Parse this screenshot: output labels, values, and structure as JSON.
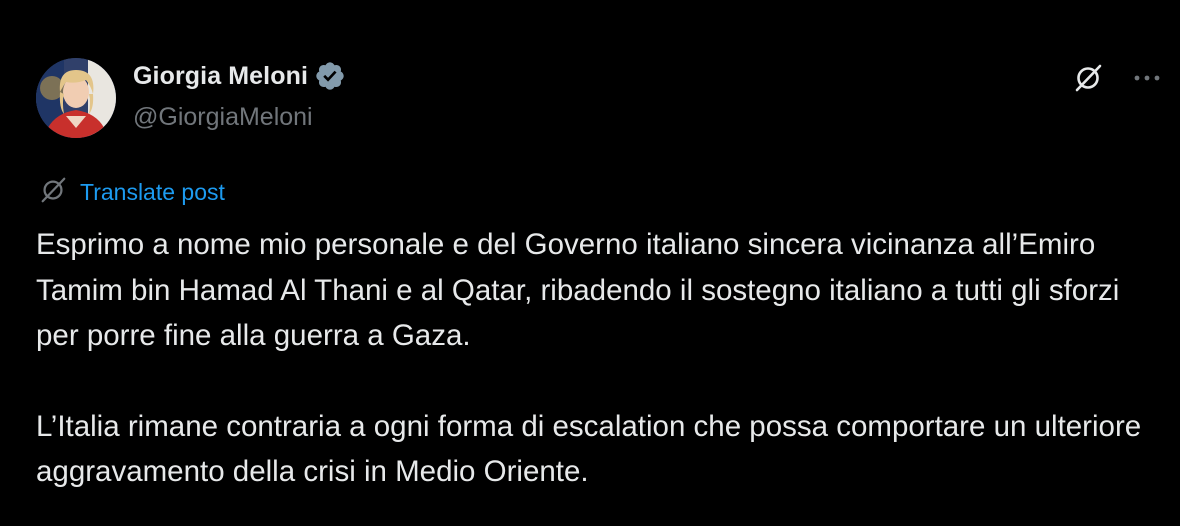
{
  "colors": {
    "background": "#000000",
    "text": "#e7e9ea",
    "secondary": "#71767b",
    "accent": "#1d9bf0"
  },
  "author": {
    "name": "Giorgia Meloni",
    "handle": "@GiorgiaMeloni",
    "verified_icon": "verified-badge-icon",
    "avatar_icon": "avatar"
  },
  "actions": {
    "grok_icon": "grok-icon",
    "more_icon": "more-options-icon"
  },
  "translate": {
    "icon": "translate-icon",
    "label": "Translate post"
  },
  "post": {
    "paragraphs": [
      "Esprimo a nome mio personale e del Governo italiano sincera vicinanza all’Emiro Tamim bin Hamad Al Thani e al Qatar, ribadendo il sostegno italiano a tutti gli sforzi per porre fine alla guerra a Gaza.",
      "L’Italia rimane contraria a ogni forma di escalation che possa comportare un ulteriore aggravamento della crisi in Medio Oriente."
    ]
  }
}
